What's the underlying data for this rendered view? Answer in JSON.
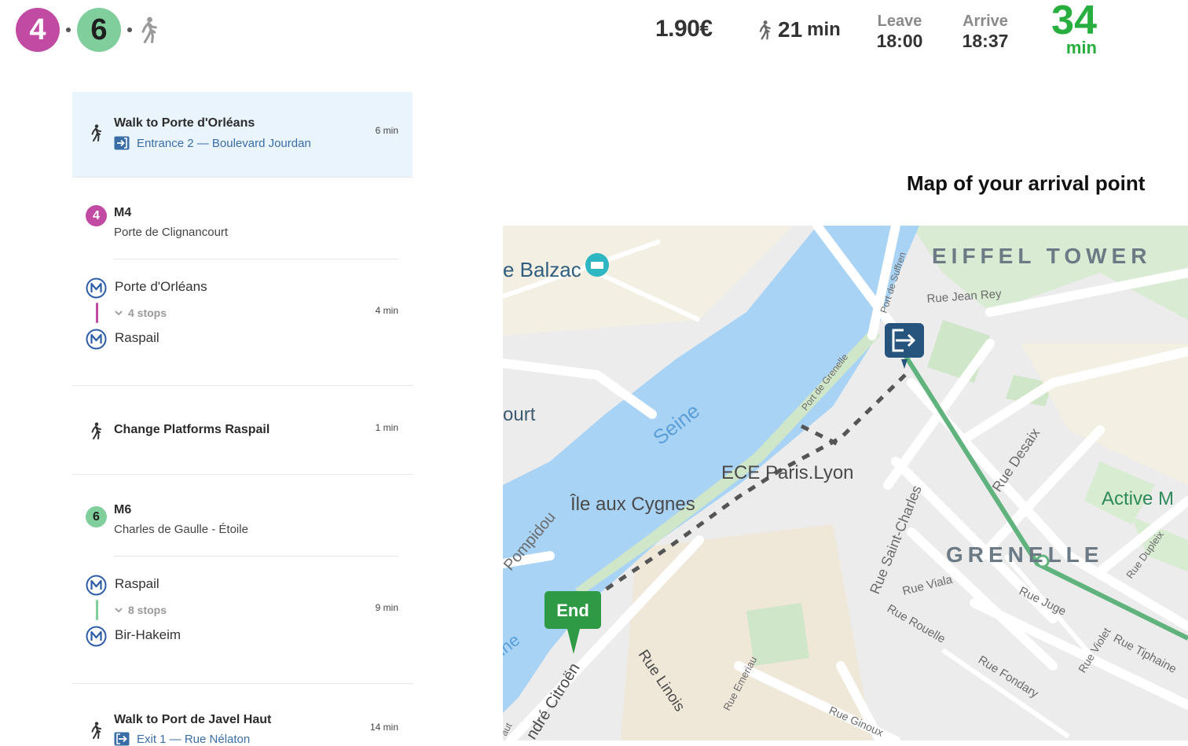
{
  "header": {
    "lines": [
      {
        "label": "4",
        "color": "#c14aa2",
        "text_color": "#ffffff"
      },
      {
        "label": "6",
        "color": "#7fce9c",
        "text_color": "#1f1f1f"
      }
    ],
    "price": "1.90€",
    "walk_time": {
      "value": "21",
      "unit": "min"
    },
    "leave": {
      "label": "Leave",
      "time": "18:00"
    },
    "arrive": {
      "label": "Arrive",
      "time": "18:37"
    },
    "duration": {
      "value": "34",
      "unit": "min"
    }
  },
  "itinerary": {
    "walk1": {
      "title": "Walk to Porte d'Orléans",
      "detail": "Entrance 2 — Boulevard Jourdan",
      "time": "6 min"
    },
    "m4": {
      "line": "4",
      "name": "M4",
      "direction": "Porte de Clignancourt",
      "from": "Porte d'Orléans",
      "stops": "4 stops",
      "to": "Raspail",
      "time": "4 min",
      "color": "#c14aa2"
    },
    "change": {
      "title": "Change Platforms Raspail",
      "time": "1 min"
    },
    "m6": {
      "line": "6",
      "name": "M6",
      "direction": "Charles de Gaulle - Étoile",
      "from": "Raspail",
      "stops": "8 stops",
      "to": "Bir-Hakeim",
      "time": "9 min",
      "color": "#7fce9c"
    },
    "walk2": {
      "title": "Walk to Port de Javel Haut",
      "detail": "Exit 1 — Rue Nélaton",
      "time": "14 min"
    }
  },
  "map": {
    "title": "Map of your arrival point",
    "labels": {
      "balzac": "e Balzac",
      "eiffel": "EIFFEL TOWER",
      "jean_rey": "Rue Jean Rey",
      "suffren": "Port de Suffren",
      "grenelle_port": "Port de Grenelle",
      "court": "ourt",
      "seine": "Seine",
      "ece": "ECE Paris.Lyon",
      "cygnes": "Île aux Cygnes",
      "pompidou": "Pompidou",
      "desaix": "Rue Desaix",
      "active": "Active M",
      "saint_charles": "Rue Saint-Charles",
      "viala": "Rue Viala",
      "grenelle": "GRENELLE",
      "dupleix": "Rue Dupleix",
      "juge": "Rue Juge",
      "rouelle": "Rue Rouelle",
      "violet": "Rue Violet",
      "tiphaine": "Rue Tiphaine",
      "fondary": "Rue Fondary",
      "end": "End",
      "seine2": "ine",
      "linois": "Rue Linois",
      "emeriau": "Rue Emeriau",
      "citroen": "ndré Citroën",
      "ginoux": "Rue Ginoux",
      "aut": "aut"
    }
  }
}
